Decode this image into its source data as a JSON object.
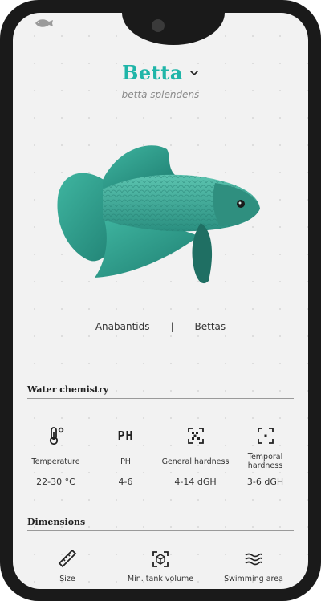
{
  "species": {
    "name": "Betta",
    "scientific_name": "betta splendens",
    "family": "Anabantids",
    "separator": "|",
    "group": "Bettas"
  },
  "water_chemistry": {
    "title": "Water chemistry",
    "items": [
      {
        "icon": "thermometer-icon",
        "label": "Temperature",
        "value": "22-30 °C"
      },
      {
        "icon": "ph-icon",
        "label": "PH",
        "icon_text": "PH",
        "value": "4-6"
      },
      {
        "icon": "general-hardness-icon",
        "label": "General hardness",
        "value": "4-14 dGH"
      },
      {
        "icon": "temporal-hardness-icon",
        "label": "Temporal hardness",
        "value": "3-6 dGH"
      }
    ]
  },
  "dimensions": {
    "title": "Dimensions",
    "items": [
      {
        "icon": "ruler-icon",
        "label": "Size"
      },
      {
        "icon": "tank-volume-icon",
        "label": "Min. tank volume"
      },
      {
        "icon": "waves-icon",
        "label": "Swimming area"
      }
    ]
  },
  "colors": {
    "accent": "#1fb5a8",
    "fish_body": "#3aa897",
    "phone_frame": "#1a1a1a",
    "background": "#f2f2f2"
  }
}
